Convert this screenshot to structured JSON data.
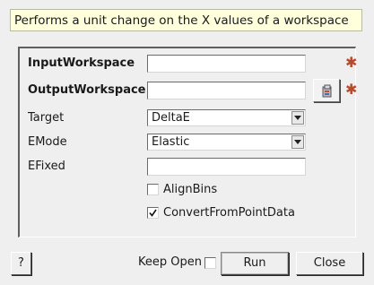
{
  "dialog": {
    "description": "Performs a unit change on the X values of a workspace"
  },
  "fields": {
    "input_workspace": {
      "label": "InputWorkspace",
      "value": ""
    },
    "output_workspace": {
      "label": "OutputWorkspace",
      "value": ""
    },
    "target": {
      "label": "Target",
      "value": "DeltaE"
    },
    "emode": {
      "label": "EMode",
      "value": "Elastic"
    },
    "efixed": {
      "label": "EFixed",
      "value": ""
    }
  },
  "options": {
    "align_bins": {
      "label": "AlignBins",
      "checked": false
    },
    "convert_from_point_data": {
      "label": "ConvertFromPointData",
      "checked": true
    }
  },
  "footer": {
    "help_label": "?",
    "keep_open_label": "Keep Open",
    "keep_open_checked": false,
    "run_label": "Run",
    "close_label": "Close"
  },
  "icons": {
    "required_marker": "required-star-icon",
    "browse": "file-browse-icon",
    "combo_arrow": "chevron-down-icon",
    "check": "check-icon"
  },
  "colors": {
    "window_bg": "#efefef",
    "description_bg": "#ffffdc",
    "required_marker": "#b64a2c"
  }
}
